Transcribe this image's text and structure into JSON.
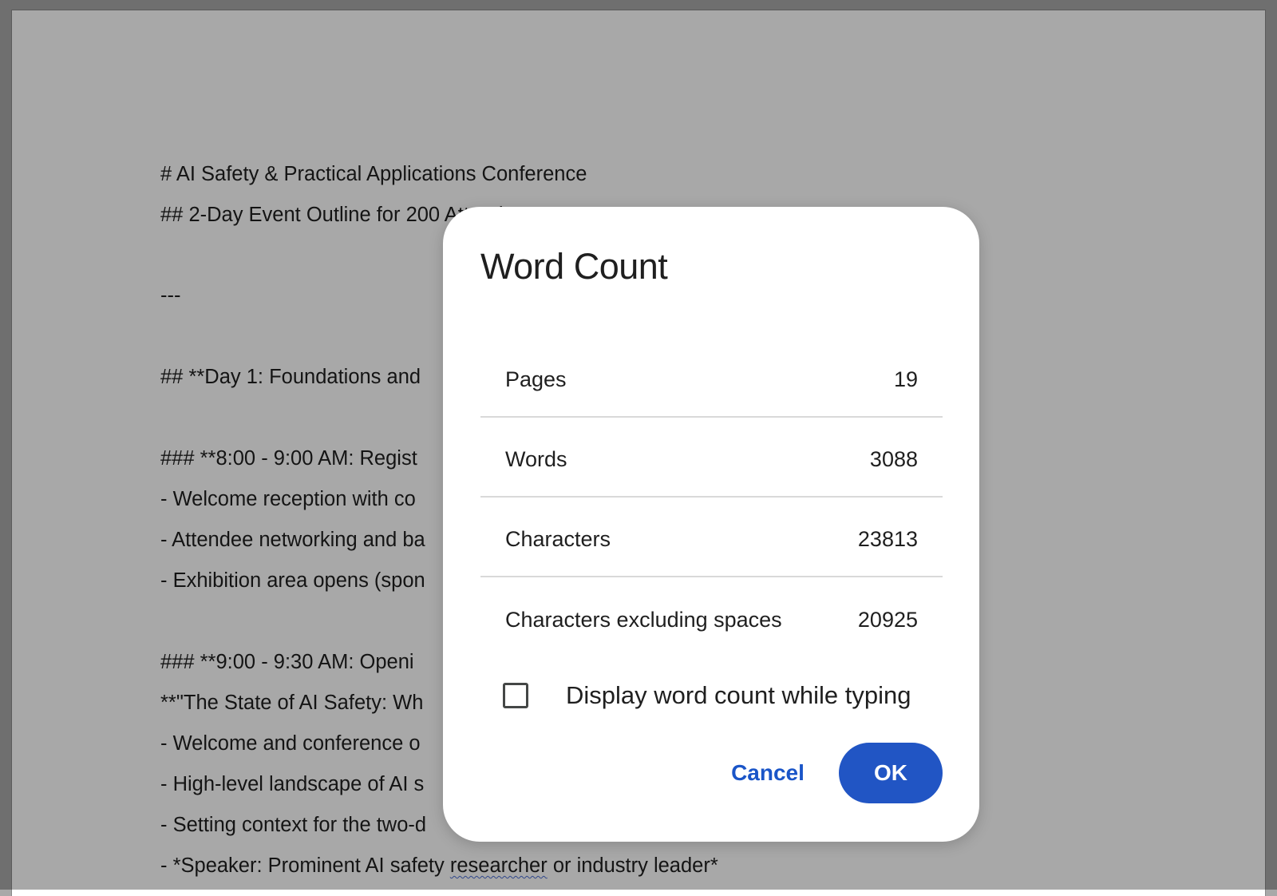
{
  "document": {
    "lines": [
      "# AI Safety & Practical Applications Conference",
      "## 2-Day Event Outline for 200 Attendees",
      "---",
      "## **Day 1: Foundations and",
      "### **8:00 - 9:00 AM: Regist",
      "- Welcome reception with co",
      "- Attendee networking and ba",
      "- Exhibition area opens (spon",
      "### **9:00 - 9:30 AM: Openi",
      "**\"The State of AI Safety: Wh",
      "- Welcome and conference o",
      "- High-level landscape of AI s",
      "- Setting context for the two-d"
    ],
    "speaker_line": {
      "prefix": "- *Speaker: Prominent AI safety ",
      "misspelled": "researcher",
      "suffix": " or industry leader*"
    }
  },
  "dialog": {
    "title": "Word Count",
    "stats": [
      {
        "label": "Pages",
        "value": "19"
      },
      {
        "label": "Words",
        "value": "3088"
      },
      {
        "label": "Characters",
        "value": "23813"
      },
      {
        "label": "Characters excluding spaces",
        "value": "20925"
      }
    ],
    "checkbox": {
      "label": "Display word count while typing",
      "checked": false
    },
    "cancel_label": "Cancel",
    "ok_label": "OK"
  },
  "colors": {
    "primary_button": "#2155c4",
    "link_button": "#1a55c8",
    "scrim": "rgba(0,0,0,0.34)"
  }
}
